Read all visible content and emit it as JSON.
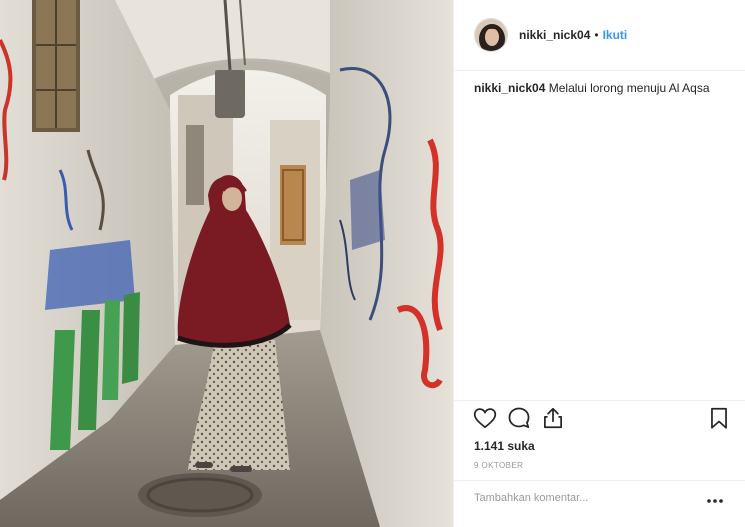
{
  "post": {
    "image_alt": "Photo: woman in dark red hijab walking through a white-walled stone alley",
    "image_icon": "photo-alley-scene"
  },
  "header": {
    "username": "nikki_nick04",
    "separator": "•",
    "follow_label": "Ikuti",
    "avatar_icon": "avatar-icon"
  },
  "caption": {
    "username": "nikki_nick04",
    "text": "Melalui lorong menuju Al Aqsa"
  },
  "actions": {
    "like_icon": "heart-icon",
    "comment_icon": "comment-icon",
    "share_icon": "share-icon",
    "save_icon": "bookmark-icon"
  },
  "stats": {
    "likes": "1.141 suka",
    "date": "9 OKTOBER"
  },
  "comment": {
    "placeholder": "Tambahkan komentar...",
    "more_icon": "more-options-icon"
  },
  "colors": {
    "link": "#3897f0",
    "text": "#262626",
    "muted": "#999999",
    "divider": "#efefef"
  }
}
